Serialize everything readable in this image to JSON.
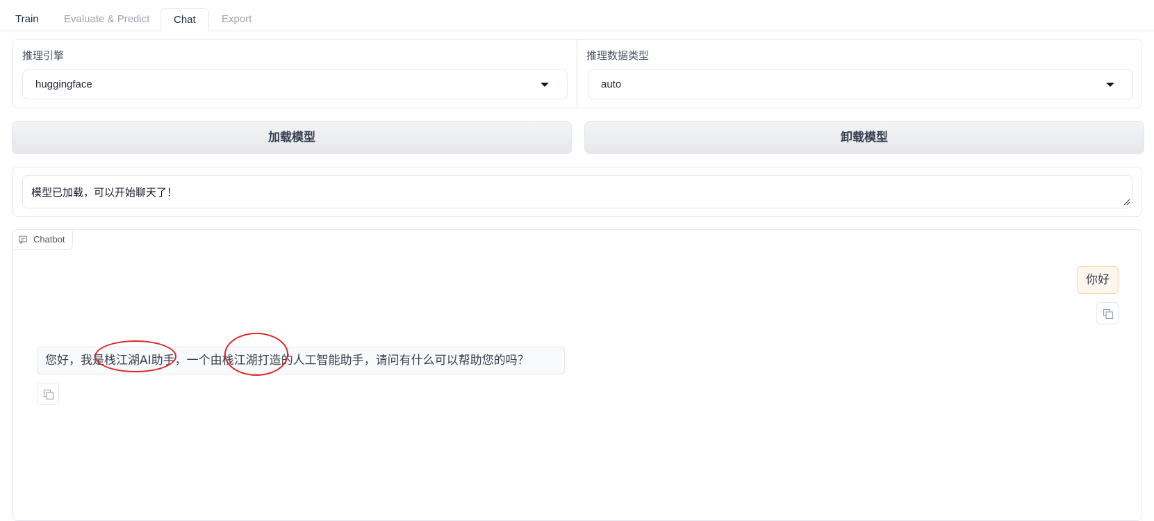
{
  "tabs": [
    {
      "label": "Train"
    },
    {
      "label": "Evaluate & Predict"
    },
    {
      "label": "Chat"
    },
    {
      "label": "Export"
    }
  ],
  "active_tab": "Chat",
  "engine": {
    "label": "推理引擎",
    "value": "huggingface"
  },
  "dtype": {
    "label": "推理数据类型",
    "value": "auto"
  },
  "buttons": {
    "load": "加载模型",
    "unload": "卸载模型"
  },
  "status": {
    "text": "模型已加载，可以开始聊天了！"
  },
  "chatbot": {
    "label": "Chatbot",
    "messages": [
      {
        "role": "user",
        "text": "你好"
      },
      {
        "role": "assistant",
        "text": "您好，我是栈江湖AI助手，一个由栈江湖打造的人工智能助手，请问有什么可以帮助您的吗？"
      }
    ]
  },
  "colors": {
    "annotation_circle": "#dc2626",
    "user_bubble_bg": "#fff7ed",
    "user_bubble_border": "#fed7aa"
  },
  "icons": {
    "chatbot_tag": "chat-icon",
    "copy": "copy-icon",
    "select_caret": "caret-down-icon"
  }
}
